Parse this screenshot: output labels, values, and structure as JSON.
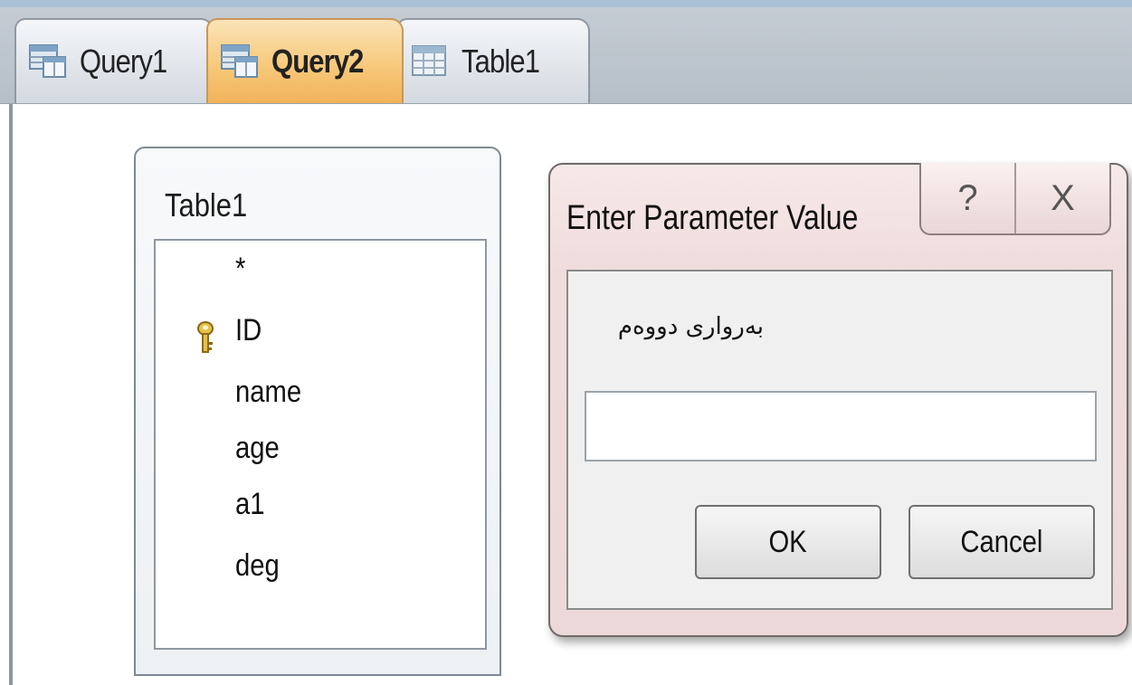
{
  "tabs": [
    {
      "label": "Query1",
      "icon": "query-icon",
      "active": false
    },
    {
      "label": "Query2",
      "icon": "query-icon",
      "active": true
    },
    {
      "label": "Table1",
      "icon": "table-icon",
      "active": false
    }
  ],
  "table_window": {
    "title": "Table1",
    "fields": [
      "*",
      "ID",
      "name",
      "age",
      "a1",
      "deg"
    ],
    "primary_key": "ID"
  },
  "dialog": {
    "title": "Enter Parameter Value",
    "help_glyph": "?",
    "close_glyph": "X",
    "prompt": "بەرواری دووەم",
    "input_value": "",
    "ok_label": "OK",
    "cancel_label": "Cancel"
  }
}
